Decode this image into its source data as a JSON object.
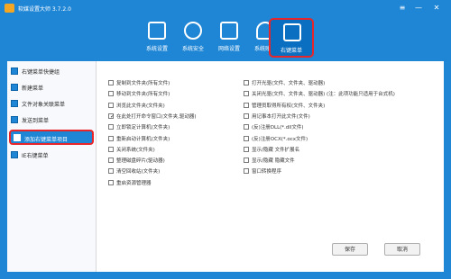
{
  "window": {
    "title": "软媒设置大师 3.7.2.0",
    "controls": [
      "≡",
      "—",
      "✕"
    ]
  },
  "toolbar": {
    "items": [
      {
        "label": "系统设置",
        "icon": "system-settings-icon"
      },
      {
        "label": "系统安全",
        "icon": "shield-icon"
      },
      {
        "label": "网络设置",
        "icon": "network-icon"
      },
      {
        "label": "系统账户",
        "icon": "users-icon"
      },
      {
        "label": "右键菜单",
        "icon": "context-menu-icon",
        "active": true
      }
    ]
  },
  "sidebar": {
    "items": [
      {
        "label": "右键菜单快捷组"
      },
      {
        "label": "新建菜单"
      },
      {
        "label": "文件对象关联菜单"
      },
      {
        "label": "发送到菜单"
      },
      {
        "label": "添加右键菜单项目",
        "active": true
      },
      {
        "label": "IE右键菜单"
      }
    ]
  },
  "options": {
    "left": [
      {
        "label": "复制到文件夹(所有文件)",
        "checked": false
      },
      {
        "label": "移动到文件夹(所有文件)",
        "checked": false
      },
      {
        "label": "浏览此文件夹(文件夹)",
        "checked": false
      },
      {
        "label": "在此处打开命令窗口(文件夹,驱动器)",
        "checked": true
      },
      {
        "label": "立即锁定计算机(文件夹)",
        "checked": false
      },
      {
        "label": "重新启动计算机(文件夹)",
        "checked": false
      },
      {
        "label": "关闭系统(文件夹)",
        "checked": false
      },
      {
        "label": "整理磁盘碎片(驱动器)",
        "checked": false
      },
      {
        "label": "清空回收站(文件夹)",
        "checked": false
      },
      {
        "label": "重启资源管理器",
        "checked": false
      }
    ],
    "right": [
      {
        "label": "打开光驱(文件、文件夹、驱动器)",
        "checked": false
      },
      {
        "label": "关闭光驱(文件、文件夹、驱动器) (注：此项功能只适用于台式机)",
        "checked": false
      },
      {
        "label": "管理员取得所有权(文件、文件夹)",
        "checked": false
      },
      {
        "label": "用记事本打开此文件(文件)",
        "checked": false
      },
      {
        "label": "(反)注册DLL(*.dll文件)",
        "checked": false
      },
      {
        "label": "(反)注册OCX(*.ocx文件)",
        "checked": false
      },
      {
        "label": "显示/隐藏 文件扩展名",
        "checked": false
      },
      {
        "label": "显示/隐藏 隐藏文件",
        "checked": false
      },
      {
        "label": "窗口转换程序",
        "checked": false
      }
    ]
  },
  "buttons": {
    "save": "保存",
    "cancel": "取消"
  },
  "colors": {
    "accent": "#1f86d6",
    "highlight": "#e8262a"
  }
}
